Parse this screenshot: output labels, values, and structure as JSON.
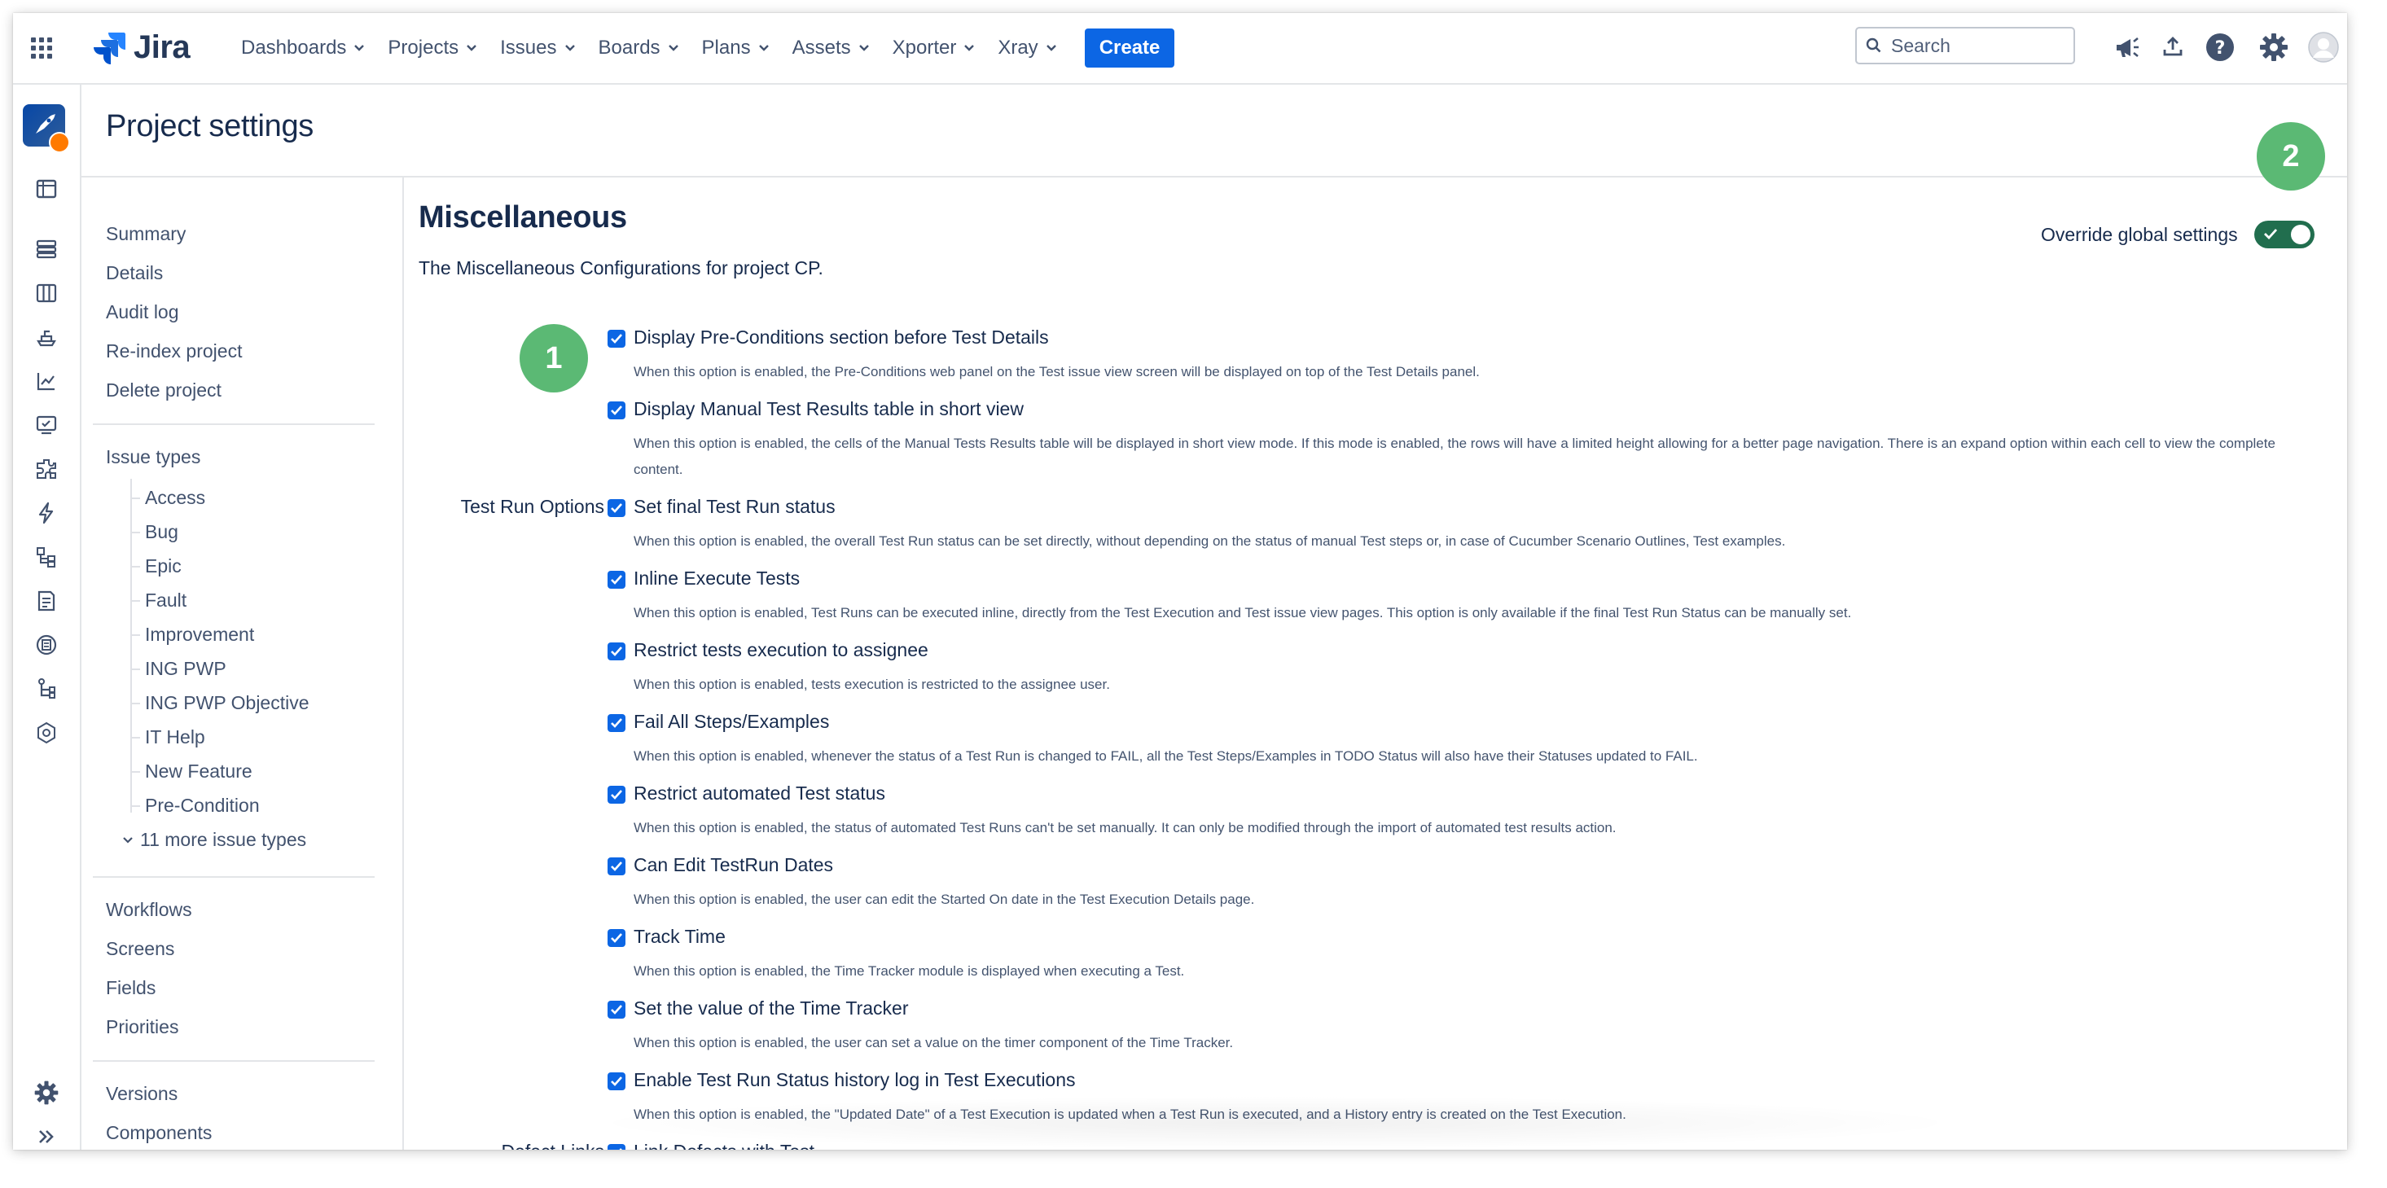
{
  "app": {
    "name": "Jira"
  },
  "nav": {
    "menus": [
      "Dashboards",
      "Projects",
      "Issues",
      "Boards",
      "Plans",
      "Assets",
      "Xporter",
      "Xray"
    ],
    "create_label": "Create",
    "search_placeholder": "Search",
    "icons": [
      "notifications-megaphone-icon",
      "upload-icon",
      "help-icon",
      "settings-gear-icon",
      "user-avatar-icon"
    ]
  },
  "rail": {
    "icons": [
      "project-avatar",
      "board-icon",
      "backlog-icon",
      "columns-icon",
      "releases-icon",
      "reports-icon",
      "test-board-icon",
      "components-icon",
      "automation-icon",
      "test-hierarchy-icon",
      "test-plan-icon",
      "test-repository-icon",
      "traceability-icon",
      "settings-icon"
    ],
    "bottom_icons": [
      "settings-gear-icon",
      "expand-sidebar-icon"
    ]
  },
  "page": {
    "title": "Project settings"
  },
  "sidebar": {
    "group1": [
      "Summary",
      "Details",
      "Audit log",
      "Re-index project",
      "Delete project"
    ],
    "issue_types_label": "Issue types",
    "issue_types": [
      "Access",
      "Bug",
      "Epic",
      "Fault",
      "Improvement",
      "ING PWP",
      "ING PWP Objective",
      "IT Help",
      "New Feature",
      "Pre-Condition"
    ],
    "more_issue_types": "11 more issue types",
    "group3": [
      "Workflows",
      "Screens",
      "Fields",
      "Priorities"
    ],
    "group4": [
      "Versions",
      "Components"
    ]
  },
  "main": {
    "title": "Miscellaneous",
    "description": "The Miscellaneous Configurations for project CP.",
    "override_label": "Override global settings",
    "override_enabled": true,
    "badges": [
      "1",
      "2"
    ],
    "groups": {
      "test_run_options": "Test Run Options",
      "defect_links": "Defect Links"
    },
    "options": [
      {
        "label": "Display Pre-Conditions section before Test Details",
        "description": "When this option is enabled, the Pre-Conditions web panel on the Test issue view screen will be displayed on top of the Test Details panel.",
        "checked": true
      },
      {
        "label": "Display Manual Test Results table in short view",
        "description": "When this option is enabled, the cells of the Manual Tests Results table will be displayed in short view mode. If this mode is enabled, the rows will have a limited height allowing for a better page navigation. There is an expand option within each cell to view the complete content.",
        "checked": true
      },
      {
        "label": "Set final Test Run status",
        "description": "When this option is enabled, the overall Test Run status can be set directly, without depending on the status of manual Test steps or, in case of Cucumber Scenario Outlines, Test examples.",
        "checked": true
      },
      {
        "label": "Inline Execute Tests",
        "description": "When this option is enabled, Test Runs can be executed inline, directly from the Test Execution and Test issue view pages. This option is only available if the final Test Run Status can be manually set.",
        "checked": true
      },
      {
        "label": "Restrict tests execution to assignee",
        "description": "When this option is enabled, tests execution is restricted to the assignee user.",
        "checked": true
      },
      {
        "label": "Fail All Steps/Examples",
        "description": "When this option is enabled, whenever the status of a Test Run is changed to FAIL, all the Test Steps/Examples in TODO Status will also have their Statuses updated to FAIL.",
        "checked": true
      },
      {
        "label": "Restrict automated Test status",
        "description": "When this option is enabled, the status of automated Test Runs can't be set manually. It can only be modified through the import of automated test results action.",
        "checked": true
      },
      {
        "label": "Can Edit TestRun Dates",
        "description": "When this option is enabled, the user can edit the Started On date in the Test Execution Details page.",
        "checked": true
      },
      {
        "label": "Track Time",
        "description": "When this option is enabled, the Time Tracker module is displayed when executing a Test.",
        "checked": true
      },
      {
        "label": "Set the value of the Time Tracker",
        "description": "When this option is enabled, the user can set a value on the timer component of the Time Tracker.",
        "checked": true
      },
      {
        "label": "Enable Test Run Status history log in Test Executions",
        "description": "When this option is enabled, the \"Updated Date\" of a Test Execution is updated when a Test Run is executed, and a History entry is created on the Test Execution.",
        "checked": true
      },
      {
        "label": "Link Defects with Test",
        "description": "",
        "checked": true
      }
    ]
  },
  "colors": {
    "primary": "#0c66e4",
    "toggle_on": "#216e4e",
    "badge": "#5bb974",
    "text": "#172b4d",
    "subtle_text": "#44546f"
  }
}
